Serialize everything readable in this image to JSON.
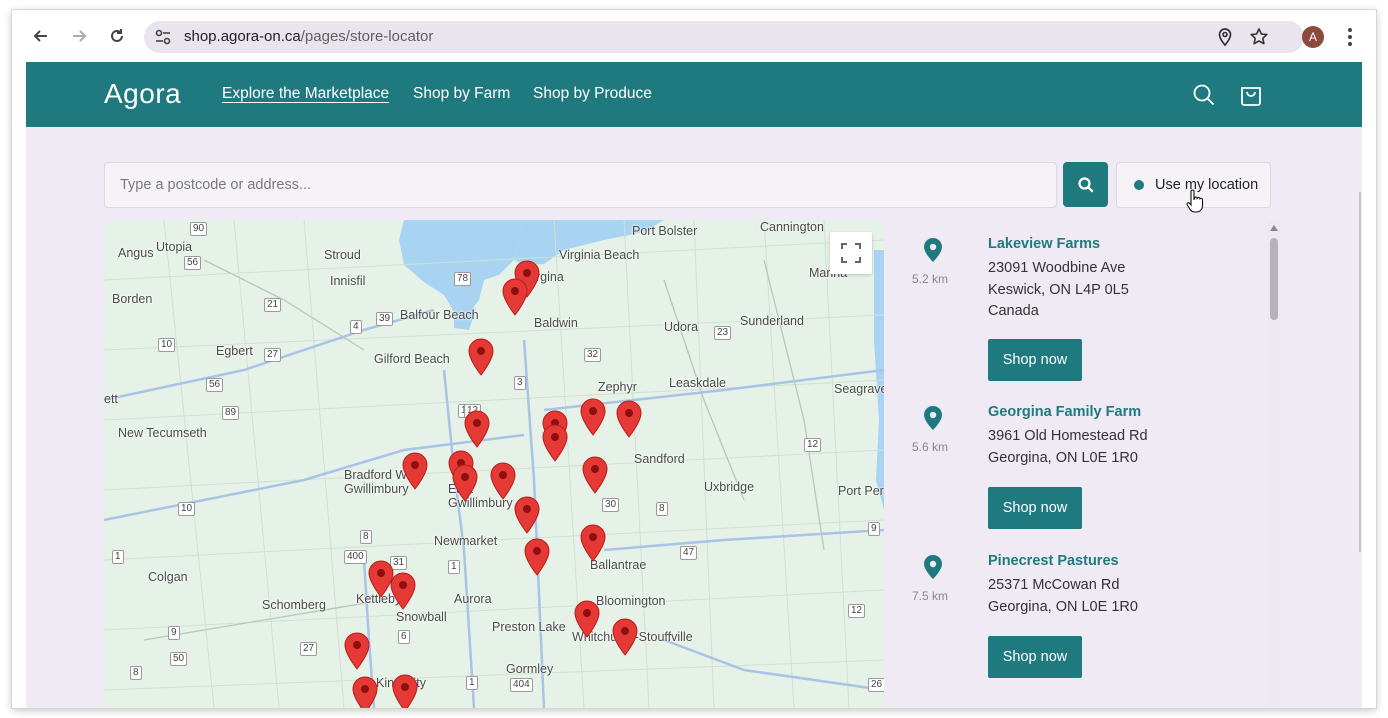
{
  "browser": {
    "url_host": "shop.agora-on.ca",
    "url_path": "/pages/store-locator",
    "profile_initial": "A",
    "icons": [
      "back-icon",
      "forward-icon",
      "reload-icon",
      "site-info-icon",
      "location-icon",
      "bookmark-star-icon",
      "kebab-menu-icon"
    ]
  },
  "header": {
    "logo": "Agora",
    "nav": [
      {
        "label": "Explore the Marketplace",
        "active": true
      },
      {
        "label": "Shop by Farm",
        "active": false
      },
      {
        "label": "Shop by Produce",
        "active": false
      }
    ],
    "icons": [
      "search-icon",
      "cart-icon"
    ]
  },
  "search": {
    "placeholder": "Type a postcode or address...",
    "value": "",
    "use_location_label": "Use my location"
  },
  "map": {
    "place_labels": [
      "Angus",
      "Utopia",
      "Stroud",
      "Innisfil",
      "Borden",
      "Egbert",
      "Gilford Beach",
      "Balfour Beach",
      "Virginia Beach",
      "Port Bolster",
      "Cannington",
      "Mariha",
      "Baldwin",
      "Udora",
      "Sunderland",
      "Zephyr",
      "Leaskdale",
      "Seagrave",
      "New Tecumseth",
      "Bradford W Gwillimbury",
      "East Gwillimbury",
      "Sandford",
      "Uxbridge",
      "Port Per",
      "Newmarket",
      "Ballantrae",
      "Colgan",
      "Schomberg",
      "Kettleby",
      "Snowball",
      "Aurora",
      "Preston Lake",
      "Bloomington",
      "Whitchurch-Stouffville",
      "Gormley",
      "King City",
      "ett",
      "rgina"
    ],
    "road_shields": [
      "90",
      "56",
      "21",
      "4",
      "39",
      "78",
      "10",
      "27",
      "56",
      "89",
      "32",
      "23",
      "3",
      "12",
      "12",
      "30",
      "8",
      "10",
      "8",
      "9",
      "47",
      "400",
      "31",
      "1",
      "1",
      "6",
      "12",
      "27",
      "9",
      "50",
      "8",
      "1",
      "404",
      "26",
      "12"
    ],
    "pin_color": "#e53935"
  },
  "stores": [
    {
      "name": "Lakeview Farms",
      "distance": "5.2 km",
      "address": [
        "23091 Woodbine Ave",
        "Keswick, ON L4P 0L5",
        "Canada"
      ],
      "button": "Shop now"
    },
    {
      "name": "Georgina Family Farm",
      "distance": "5.6 km",
      "address": [
        "3961 Old Homestead Rd",
        "Georgina, ON L0E 1R0"
      ],
      "button": "Shop now"
    },
    {
      "name": "Pinecrest Pastures",
      "distance": "7.5 km",
      "address": [
        "25371 McCowan Rd",
        "Georgina, ON L0E 1R0"
      ],
      "button": "Shop now"
    }
  ],
  "colors": {
    "brand": "#1f7a80",
    "page_bg": "#efeaf4",
    "pin": "#e53935"
  }
}
